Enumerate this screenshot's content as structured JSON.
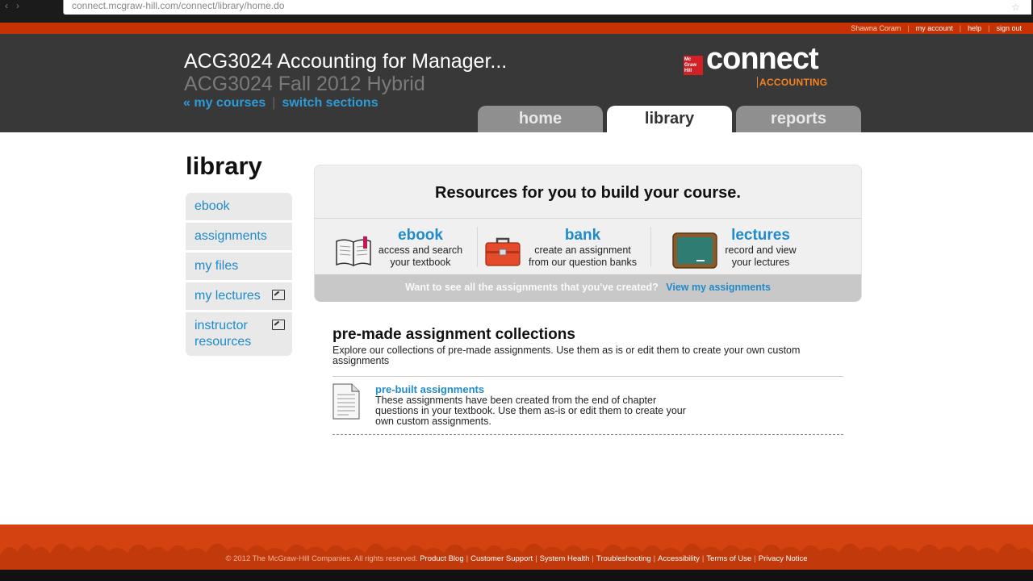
{
  "browser": {
    "url": "connect.mcgraw-hill.com/connect/library/home.do"
  },
  "util": {
    "user": "Shawna Coram",
    "my_account": "my account",
    "help": "help",
    "sign_out": "sign out"
  },
  "header": {
    "course_title": "ACG3024 Accounting for Manager...",
    "course_section": "ACG3024 Fall 2012 Hybrid",
    "my_courses": "« my courses",
    "switch_sections": "switch sections",
    "logo_brand": "connect",
    "logo_sub": "ACCOUNTING",
    "logo_mark": "Mc Graw Hill"
  },
  "tabs": [
    {
      "label": "home",
      "active": false
    },
    {
      "label": "library",
      "active": true
    },
    {
      "label": "reports",
      "active": false
    }
  ],
  "page_title": "library",
  "sidebar": {
    "items": [
      {
        "label": "ebook"
      },
      {
        "label": "assignments"
      },
      {
        "label": "my files"
      },
      {
        "label": "my lectures",
        "external": true
      },
      {
        "label": "instructor resources",
        "external": true
      }
    ]
  },
  "resources": {
    "heading": "Resources for you to build your course.",
    "items": [
      {
        "title": "ebook",
        "desc_line1": "access and search",
        "desc_line2": "your textbook"
      },
      {
        "title": "bank",
        "desc_line1": "create an assignment",
        "desc_line2": "from our question banks"
      },
      {
        "title": "lectures",
        "desc_line1": "record and view",
        "desc_line2": "your lectures"
      }
    ],
    "question": "Want to see all the assignments that you've created?",
    "view_link": "View my assignments"
  },
  "collections": {
    "title": "pre-made assignment collections",
    "desc": "Explore our collections of pre-made assignments. Use them as is or edit them to create your own custom assignments",
    "items": [
      {
        "title": "pre-built assignments",
        "desc": "These assignments have been created from the end of chapter questions in your textbook. Use them as-is or edit them to create your own custom assignments."
      }
    ]
  },
  "footer": {
    "copyright": "© 2012 The McGraw-Hill Companies. All rights reserved.",
    "links": [
      "Product Blog",
      "Customer Support",
      "System Health",
      "Troubleshooting",
      "Accessibility",
      "Terms of Use",
      "Privacy Notice"
    ]
  },
  "colors": {
    "accent_orange": "#c63204",
    "link_blue": "#1f8bc9",
    "header_dark": "#383838"
  }
}
